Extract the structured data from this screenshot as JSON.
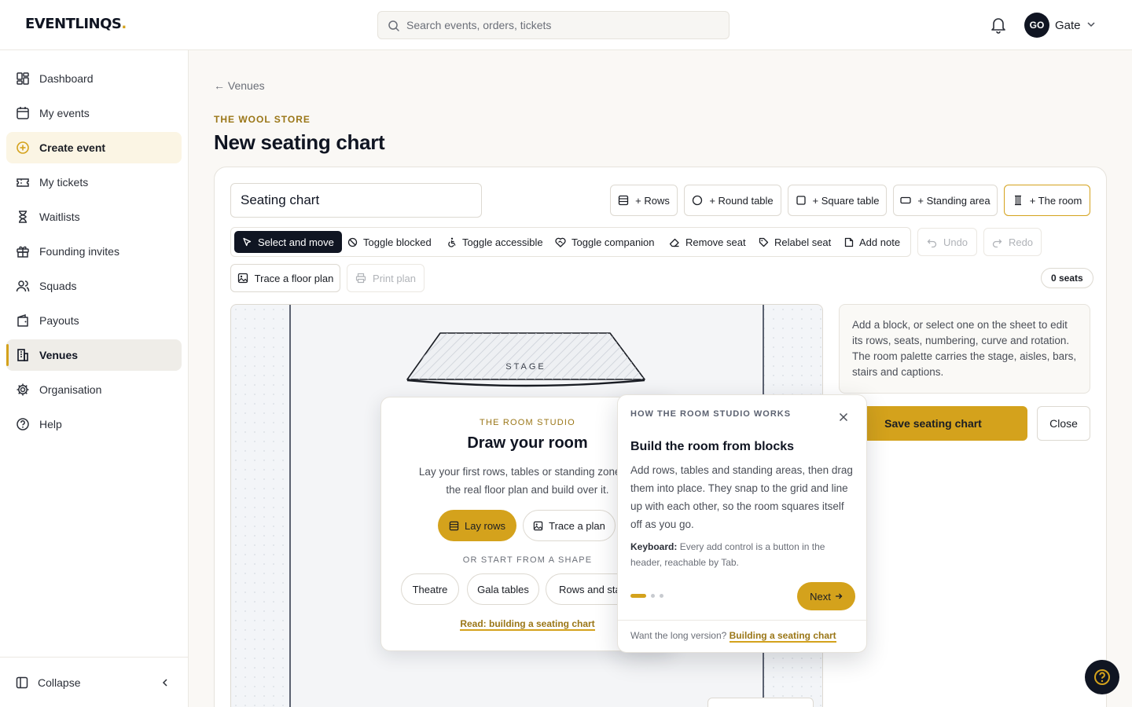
{
  "app": {
    "logo": "EVENTLINQS",
    "logo_dot": "."
  },
  "search": {
    "placeholder": "Search events, orders, tickets"
  },
  "user": {
    "initials": "GO",
    "name": "Gate"
  },
  "sidebar": {
    "items": [
      {
        "label": "Dashboard",
        "icon": "dashboard-icon"
      },
      {
        "label": "My events",
        "icon": "calendar-icon"
      },
      {
        "label": "Create event",
        "icon": "plus-circle-icon"
      },
      {
        "label": "My tickets",
        "icon": "ticket-icon"
      },
      {
        "label": "Waitlists",
        "icon": "hourglass-icon"
      },
      {
        "label": "Founding invites",
        "icon": "gift-icon"
      },
      {
        "label": "Squads",
        "icon": "users-icon"
      },
      {
        "label": "Payouts",
        "icon": "wallet-icon"
      },
      {
        "label": "Venues",
        "icon": "building-icon"
      },
      {
        "label": "Organisation",
        "icon": "gear-icon"
      },
      {
        "label": "Help",
        "icon": "help-circle-icon"
      }
    ],
    "collapse_label": "Collapse"
  },
  "page": {
    "back_link": "← Venues",
    "venue": "THE WOOL STORE",
    "title": "New seating chart"
  },
  "editor": {
    "chart_name": "Seating chart",
    "add_buttons": [
      "+ Rows",
      "+ Round table",
      "+ Square table",
      "+ Standing area",
      "+ The room"
    ],
    "tools": [
      "Select and move",
      "Toggle blocked",
      "Toggle accessible",
      "Toggle companion",
      "Remove seat",
      "Relabel seat",
      "Add note"
    ],
    "undo": "Undo",
    "redo": "Redo",
    "trace": "Trace a floor plan",
    "print": "Print plan",
    "seat_count": "0 seats",
    "stage_label": "STAGE",
    "info": "Add a block, or select one on the sheet to edit its rows, seats, numbering, curve and rotation. The room palette carries the stage, aisles, bars, stairs and captions.",
    "save": "Save seating chart",
    "close": "Close"
  },
  "studio": {
    "eyebrow": "THE ROOM STUDIO",
    "title": "Draw your room",
    "body_line1": "Lay your first rows, tables or standing zone, or",
    "body_line2": "the real floor plan and build over it.",
    "primary": "Lay rows",
    "secondary": "Trace a plan",
    "or": "OR START FROM A SHAPE",
    "shapes": [
      "Theatre",
      "Gala tables",
      "Rows and stage"
    ],
    "link": "Read: building a seating chart"
  },
  "tour": {
    "eyebrow": "HOW THE ROOM STUDIO WORKS",
    "title": "Build the room from blocks",
    "body": "Add rows, tables and standing areas, then drag them into place. They snap to the grid and line up with each other, so the room squares itself off as you go.",
    "kb_label": "Keyboard:",
    "kb_text": "Every add control is a button in the header, reachable by Tab.",
    "next": "Next",
    "foot_text": "Want the long version?",
    "foot_link": "Building a seating chart"
  },
  "colors": {
    "accent": "#d4a21c",
    "ink": "#101522"
  }
}
